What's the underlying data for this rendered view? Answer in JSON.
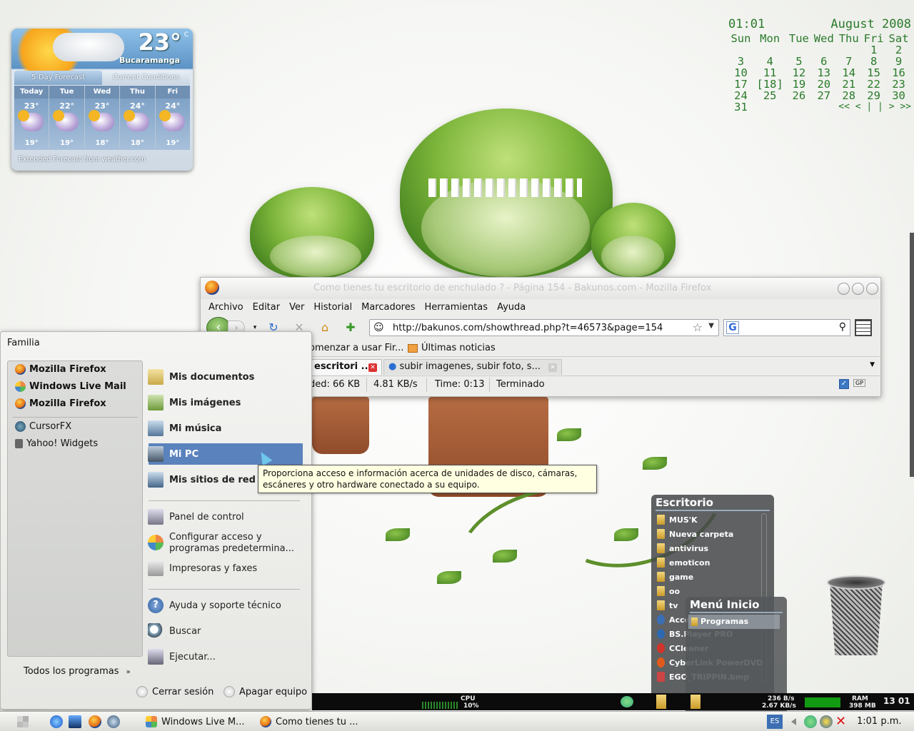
{
  "weather": {
    "temp": "23°",
    "unit": "C",
    "city": "Bucaramanga",
    "tabs": [
      "5-Day Forecast",
      "Current Conditions"
    ],
    "days": [
      {
        "name": "Today",
        "high": "23°",
        "low": "19°"
      },
      {
        "name": "Tue",
        "high": "22°",
        "low": "19°"
      },
      {
        "name": "Wed",
        "high": "23°",
        "low": "18°"
      },
      {
        "name": "Thu",
        "high": "24°",
        "low": "18°"
      },
      {
        "name": "Fri",
        "high": "24°",
        "low": "19°"
      }
    ],
    "footer": "Extended Forecast from weather.com"
  },
  "calendar": {
    "time": "01:01",
    "month": "August 2008",
    "weekdays": [
      "Sun",
      "Mon",
      "Tue",
      "Wed",
      "Thu",
      "Fri",
      "Sat"
    ],
    "weeks": [
      [
        "",
        "",
        "",
        "",
        "",
        "1",
        "2"
      ],
      [
        "3",
        "4",
        "5",
        "6",
        "7",
        "8",
        "9"
      ],
      [
        "10",
        "11",
        "12",
        "13",
        "14",
        "15",
        "16"
      ],
      [
        "17",
        "[18]",
        "19",
        "20",
        "21",
        "22",
        "23"
      ],
      [
        "24",
        "25",
        "26",
        "27",
        "28",
        "29",
        "30"
      ],
      [
        "31",
        "",
        "",
        "",
        "",
        "",
        ""
      ]
    ],
    "nav": "<< < | | > >>"
  },
  "firefox": {
    "title": "Como tienes tu escritorio de enchulado ? - Página 154 - Bakunos.com - Mozilla Firefox",
    "menu": [
      "Archivo",
      "Editar",
      "Ver",
      "Historial",
      "Marcadores",
      "Herramientas",
      "Ayuda"
    ],
    "url": "http://bakunos.com/showthread.php?t=46573&page=154",
    "search_value": "",
    "bookmarks": [
      "omenzar a usar Fir...",
      "Últimas noticias"
    ],
    "tabs": [
      "escritori ...",
      "subir imagenes, subir foto, s..."
    ],
    "status": {
      "loaded": "ded: 66 KB",
      "speed": "4.81 KB/s",
      "time": "Time: 0:13",
      "state": "Terminado",
      "gp": "GP"
    }
  },
  "start_menu": {
    "user": "Familia",
    "pinned": [
      "Mozilla Firefox",
      "Windows Live Mail",
      "Mozilla Firefox"
    ],
    "recent": [
      "CursorFX",
      "Yahoo! Widgets"
    ],
    "all_programs": "Todos los programas",
    "places": [
      "Mis documentos",
      "Mis imágenes",
      "Mi música",
      "Mi PC",
      "Mis sitios de red"
    ],
    "settings": [
      "Panel de control",
      "Configurar acceso y",
      "programas predetermina...",
      "Impresoras y faxes"
    ],
    "help": [
      "Ayuda y soporte técnico",
      "Buscar",
      "Ejecutar..."
    ],
    "logoff": "Cerrar sesión",
    "shutdown": "Apagar equipo"
  },
  "tooltip": {
    "line1": "Proporciona acceso e información acerca de unidades de disco, cámaras,",
    "line2": "escáneres y otro hardware conectado a su equipo."
  },
  "desktop_stack": {
    "title": "Escritorio",
    "items": [
      "MUS'K",
      "Nueva carpeta",
      "antivirus",
      "emoticon",
      "game",
      "oo",
      "tv",
      "Acce",
      "BS.Player PRO",
      "CCleaner",
      "CyberLink PowerDVD",
      "EGO_TRIPPIN.bmp"
    ]
  },
  "menu_inicio": {
    "title": "Menú Inicio",
    "item": "Programas"
  },
  "sysbar": {
    "cpu_label": "CPU",
    "cpu": "10%",
    "net_up": "236 B/s",
    "net_down": "2.67 KB/s",
    "ram_label": "RAM",
    "ram": "398 MB",
    "time": "13 01"
  },
  "taskbar": {
    "items": [
      "Windows Live M...",
      "Como tienes tu ..."
    ],
    "lang": "ES",
    "clock": "1:01 p.m."
  }
}
